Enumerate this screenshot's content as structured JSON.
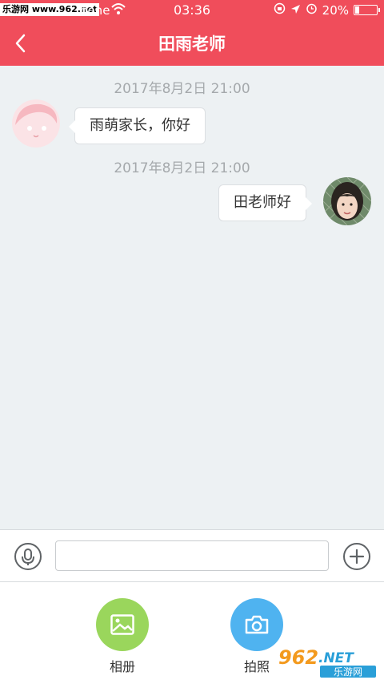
{
  "status_bar": {
    "watermark": "乐游网 www.962.net",
    "carrier": "hone",
    "time": "03:36",
    "battery": "20%",
    "battery_level": 0.2
  },
  "header": {
    "title": "田雨老师"
  },
  "messages": [
    {
      "timestamp": "2017年8月2日   21:00",
      "side": "left",
      "text": "雨萌家长，你好"
    },
    {
      "timestamp": "2017年8月2日   21:00",
      "side": "right",
      "text": "田老师好"
    }
  ],
  "input_bar": {
    "value": "",
    "placeholder": ""
  },
  "panel": {
    "items": [
      {
        "label": "相册",
        "icon": "photo-album-icon",
        "color": "#9ad65c"
      },
      {
        "label": "拍照",
        "icon": "camera-icon",
        "color": "#4fb3f0"
      }
    ]
  },
  "watermark_bottom": {
    "text1": "962",
    "text2": ".NET",
    "text3": "乐游网"
  },
  "colors": {
    "accent": "#f04d5b",
    "chat_background": "#edf1f3"
  }
}
